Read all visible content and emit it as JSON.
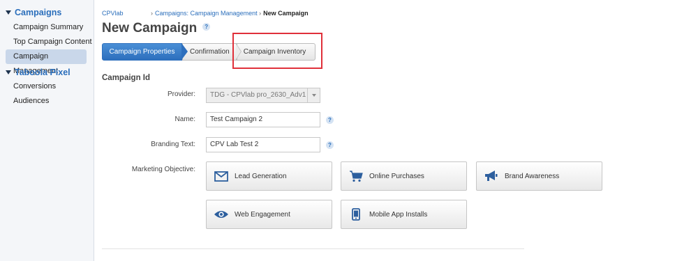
{
  "sidebar": {
    "groups": [
      {
        "label": "Campaigns",
        "items": [
          "Campaign Summary",
          "Top Campaign Content",
          "Campaign Management"
        ]
      },
      {
        "label": "Taboola Pixel",
        "items": [
          "Conversions",
          "Audiences"
        ]
      }
    ],
    "active_item": "Campaign Management"
  },
  "breadcrumb": {
    "home": "CPVlab",
    "parent": "Campaigns: Campaign Management",
    "sep": "›",
    "current": "New Campaign"
  },
  "page_title": "New Campaign",
  "help_glyph": "?",
  "wizard": {
    "steps": [
      "Campaign Properties",
      "Confirmation",
      "Campaign Inventory"
    ],
    "active_step": "Campaign Properties"
  },
  "form": {
    "section_title": "Campaign Id",
    "provider": {
      "label": "Provider:",
      "value": "TDG - CPVlab pro_2630_Adv1"
    },
    "name": {
      "label": "Name:",
      "value": "Test Campaign 2"
    },
    "branding": {
      "label": "Branding Text:",
      "value": "CPV Lab Test 2"
    },
    "objective": {
      "label": "Marketing Objective:",
      "options": [
        {
          "label": "Lead Generation",
          "icon": "envelope-icon"
        },
        {
          "label": "Online Purchases",
          "icon": "cart-icon"
        },
        {
          "label": "Brand Awareness",
          "icon": "megaphone-icon"
        },
        {
          "label": "Web Engagement",
          "icon": "eye-icon"
        },
        {
          "label": "Mobile App Installs",
          "icon": "mobile-icon"
        }
      ]
    }
  },
  "colors": {
    "accent": "#2a6ebb",
    "highlight_box": "#e0303a",
    "icon": "#2d5f9e"
  }
}
